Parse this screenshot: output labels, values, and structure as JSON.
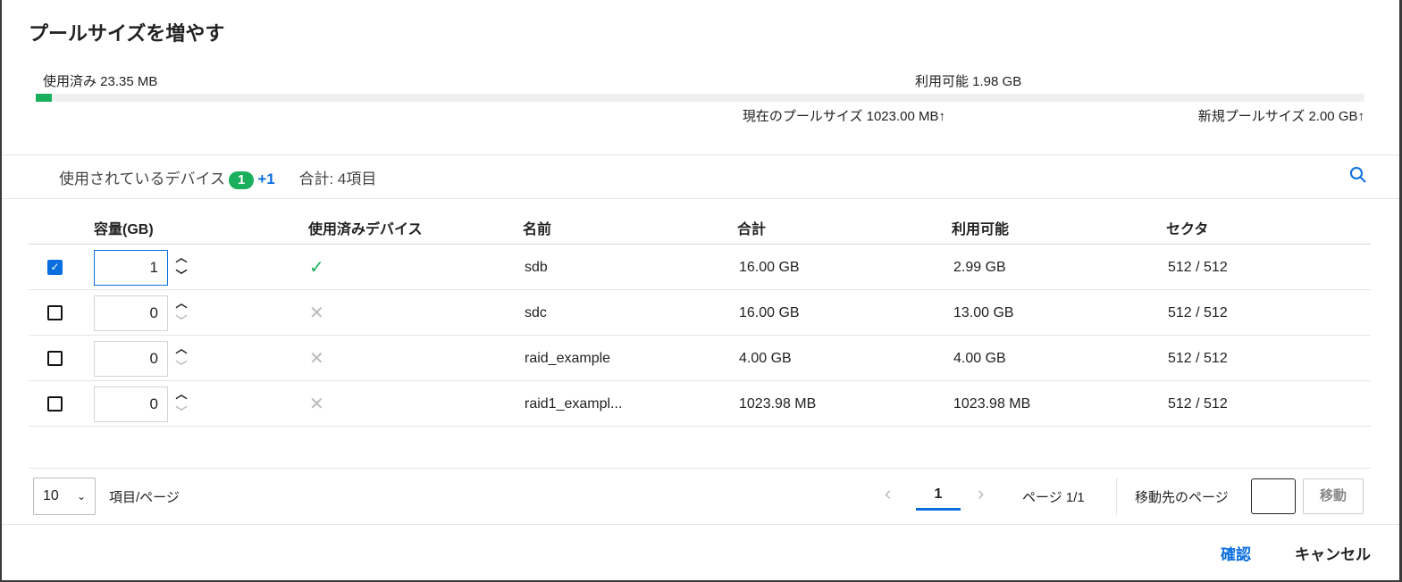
{
  "title": "プールサイズを増やす",
  "usage": {
    "used_label": "使用済み 23.35 MB",
    "available_label": "利用可能 1.98 GB",
    "current_pool": "現在のプールサイズ 1023.00 MB↑",
    "new_pool": "新規プールサイズ 2.00 GB↑",
    "used_fraction": 0.012
  },
  "devices": {
    "label": "使用されているデバイス",
    "count": "1",
    "plus": "+1",
    "total": "合計: 4項目"
  },
  "columns": [
    "容量(GB)",
    "使用済みデバイス",
    "名前",
    "合計",
    "利用可能",
    "セクタ"
  ],
  "rows": [
    {
      "checked": true,
      "capacity": "1",
      "used": true,
      "name": "sdb",
      "total": "16.00 GB",
      "available": "2.99 GB",
      "sector": "512 / 512"
    },
    {
      "checked": false,
      "capacity": "0",
      "used": false,
      "name": "sdc",
      "total": "16.00 GB",
      "available": "13.00 GB",
      "sector": "512 / 512"
    },
    {
      "checked": false,
      "capacity": "0",
      "used": false,
      "name": "raid_example",
      "total": "4.00 GB",
      "available": "4.00 GB",
      "sector": "512 / 512"
    },
    {
      "checked": false,
      "capacity": "0",
      "used": false,
      "name": "raid1_exampl...",
      "total": "1023.98 MB",
      "available": "1023.98 MB",
      "sector": "512 / 512"
    }
  ],
  "pagination": {
    "page_size": "10",
    "per_page_label": "項目/ページ",
    "current_page": "1",
    "page_info": "ページ 1/1",
    "goto_label": "移動先のページ",
    "goto_value": "",
    "goto_button": "移動"
  },
  "footer": {
    "confirm": "確認",
    "cancel": "キャンセル"
  }
}
